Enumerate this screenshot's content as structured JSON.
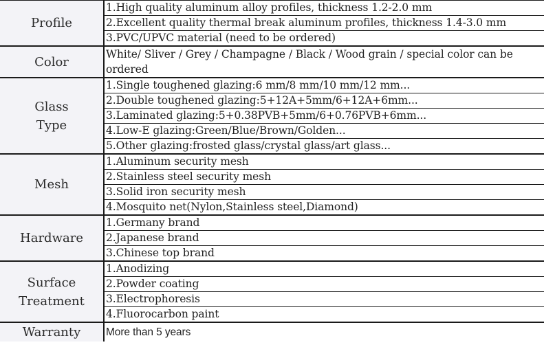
{
  "spec_table": {
    "profile": {
      "label": "Profile",
      "items": [
        "1.High quality aluminum alloy profiles, thickness 1.2-2.0 mm",
        "2.Excellent quality thermal break aluminum profiles, thickness 1.4-3.0 mm",
        "3.PVC/UPVC material (need to be ordered)"
      ]
    },
    "color": {
      "label": "Color",
      "text": "White/ Sliver / Grey / Champagne / Black / Wood grain / special color can be ordered"
    },
    "glass_type": {
      "label_line1": "Glass",
      "label_line2": "Type",
      "items": [
        "1.Single toughened glazing:6 mm/8 mm/10 mm/12 mm...",
        "2.Double toughened glazing:5+12A+5mm/6+12A+6mm...",
        "3.Laminated glazing:5+0.38PVB+5mm/6+0.76PVB+6mm...",
        "4.Low-E glazing:Green/Blue/Brown/Golden...",
        "5.Other glazing:frosted glass/crystal glass/art glass..."
      ]
    },
    "mesh": {
      "label": "Mesh",
      "items": [
        "1.Aluminum security mesh",
        "2.Stainless steel security mesh",
        "3.Solid iron security mesh",
        "4.Mosquito net(Nylon,Stainless steel,Diamond)"
      ]
    },
    "hardware": {
      "label": "Hardware",
      "items": [
        "1.Germany brand",
        "2.Japanese brand",
        "3.Chinese top brand"
      ]
    },
    "surface_treatment": {
      "label_line1": "Surface",
      "label_line2": "Treatment",
      "items": [
        "1.Anodizing",
        "2.Powder coating",
        "3.Electrophoresis",
        "4.Fluorocarbon paint"
      ]
    },
    "warranty": {
      "label": "Warranty",
      "text": "More than 5 years"
    }
  }
}
